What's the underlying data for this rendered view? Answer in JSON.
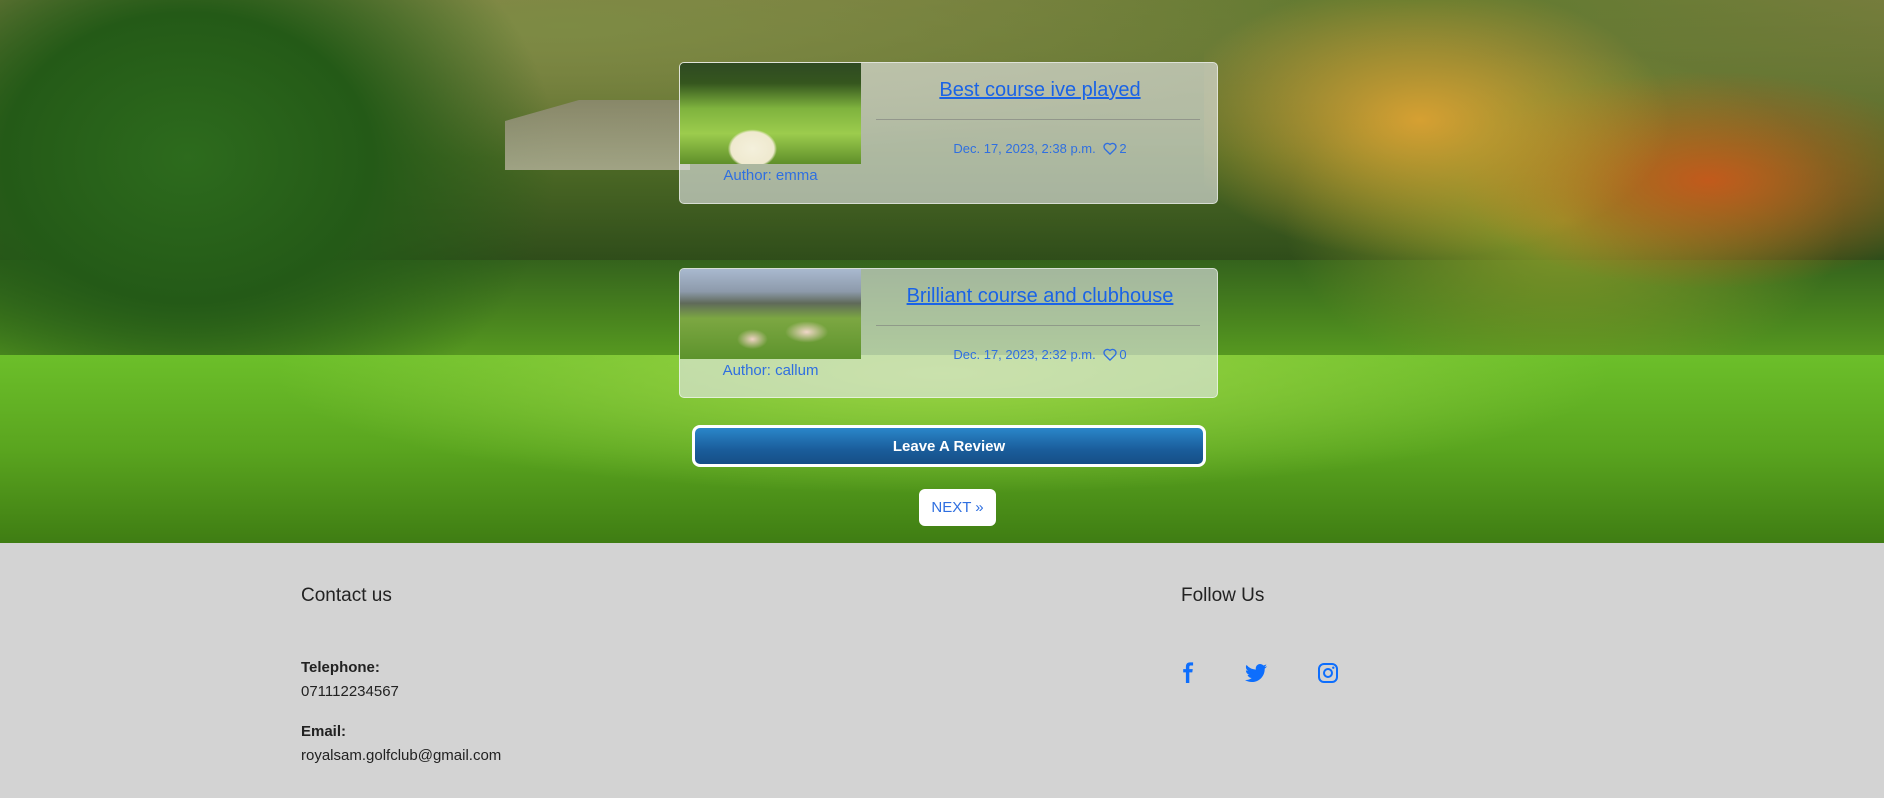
{
  "reviews": [
    {
      "title": "Best course ive played",
      "author": "Author: emma",
      "date": "Dec. 17, 2023, 2:38 p.m.",
      "likes": "2"
    },
    {
      "title": "Brilliant course and clubhouse",
      "author": "Author: callum",
      "date": "Dec. 17, 2023, 2:32 p.m.",
      "likes": "0"
    }
  ],
  "actions": {
    "leave_review": "Leave A Review",
    "next": "NEXT »"
  },
  "footer": {
    "contact_heading": "Contact us",
    "telephone_label": "Telephone:",
    "telephone_value": "071112234567",
    "email_label": "Email:",
    "email_value": "royalsam.golfclub@gmail.com",
    "follow_heading": "Follow Us",
    "social_icons": [
      "facebook-icon",
      "twitter-icon",
      "instagram-icon"
    ]
  },
  "colors": {
    "link": "#1a63e6",
    "button": "#1a5d9b",
    "footer_bg": "#d3d3d3"
  }
}
